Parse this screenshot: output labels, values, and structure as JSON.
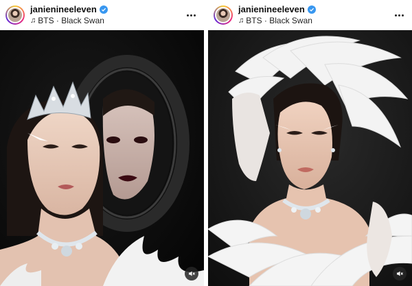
{
  "posts": [
    {
      "username": "janienineeleven",
      "audio": "BTS · Black Swan"
    },
    {
      "username": "janienineeleven",
      "audio": "BTS · Black Swan"
    }
  ],
  "icons": {
    "verified": "verified-badge-icon",
    "music": "music-note-icon",
    "more": "more-options-icon",
    "mute": "audio-muted-icon"
  },
  "colors": {
    "verified": "#3897f0",
    "text": "#111111",
    "photo_bg_left": "#0b0b0b",
    "photo_bg_right": "#161616"
  }
}
